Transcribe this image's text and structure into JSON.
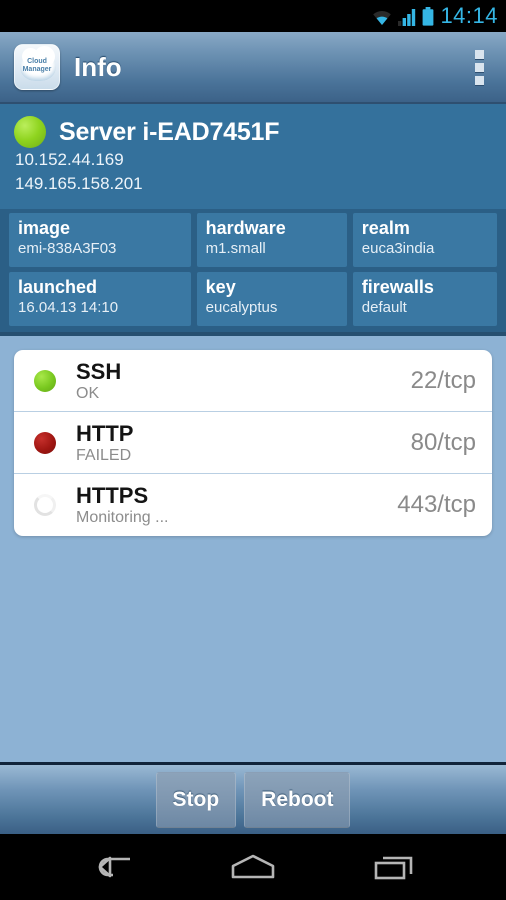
{
  "statusbar": {
    "clock": "14:14",
    "icons": [
      "wifi-icon",
      "signal-icon",
      "battery-icon"
    ]
  },
  "actionbar": {
    "app_icon_line1": "Cloud",
    "app_icon_line2": "Manager",
    "title": "Info",
    "overflow_label": "More options"
  },
  "server": {
    "status_color": "#8fd41f",
    "title": "Server i-EAD7451F",
    "ip_private": "10.152.44.169",
    "ip_public": "149.165.158.201"
  },
  "meta": {
    "rows": [
      [
        {
          "key": "image",
          "value": "emi-838A3F03"
        },
        {
          "key": "hardware",
          "value": "m1.small"
        },
        {
          "key": "realm",
          "value": "euca3india"
        }
      ],
      [
        {
          "key": "launched",
          "value": "16.04.13 14:10"
        },
        {
          "key": "key",
          "value": "eucalyptus"
        },
        {
          "key": "firewalls",
          "value": "default"
        }
      ]
    ]
  },
  "services": [
    {
      "name": "SSH",
      "state": "OK",
      "port": "22/tcp",
      "indicator": "green",
      "color": "#79c81f"
    },
    {
      "name": "HTTP",
      "state": "FAILED",
      "port": "80/tcp",
      "indicator": "red",
      "color": "#a01612"
    },
    {
      "name": "HTTPS",
      "state": "Monitoring ...",
      "port": "443/tcp",
      "indicator": "spinner",
      "color": "#e2e2e2"
    }
  ],
  "buttons": {
    "stop": "Stop",
    "reboot": "Reboot"
  },
  "navbar": {
    "back": "back-icon",
    "home": "home-icon",
    "recents": "recent-apps-icon"
  }
}
